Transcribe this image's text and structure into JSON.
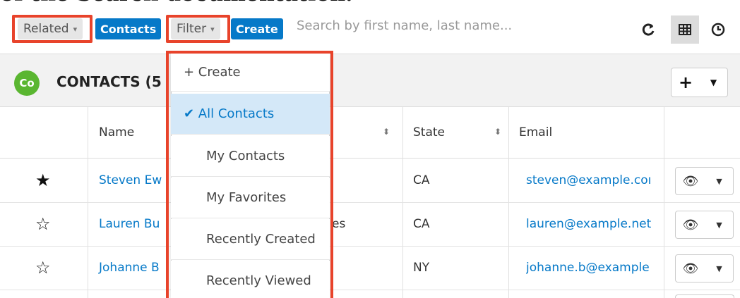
{
  "doc": {
    "partial_text": "of the Search documentation."
  },
  "toolbar": {
    "related_label": "Related",
    "contacts_label": "Contacts",
    "filter_label": "Filter",
    "create_label": "Create",
    "search_placeholder": "Search by first name, last name...",
    "icons": [
      "refresh-icon",
      "list-view-icon",
      "activity-stream-icon"
    ]
  },
  "header": {
    "badge": "Co",
    "title": "CONTACTS (5"
  },
  "table": {
    "columns": [
      "Name",
      "State",
      "Email"
    ],
    "rows": [
      {
        "favorite": true,
        "name": "Steven Ew",
        "title_tail": "",
        "state": "CA",
        "email": "steven@example.coı"
      },
      {
        "favorite": false,
        "name": "Lauren Bu",
        "title_tail": "es",
        "state": "CA",
        "email": "lauren@example.net"
      },
      {
        "favorite": false,
        "name": "Johanne B",
        "title_tail": "",
        "state": "NY",
        "email": "johanne.b@example"
      }
    ]
  },
  "filter_menu": {
    "items": [
      {
        "label": "+ Create",
        "selected": false
      },
      {
        "label": "✔ All Contacts",
        "selected": true
      },
      {
        "label": "My Contacts",
        "selected": false
      },
      {
        "label": "My Favorites",
        "selected": false
      },
      {
        "label": "Recently Created",
        "selected": false
      },
      {
        "label": "Recently Viewed",
        "selected": false
      }
    ]
  },
  "colors": {
    "accent": "#0679c8",
    "highlight": "#e8432b",
    "badge": "#5ab631"
  }
}
